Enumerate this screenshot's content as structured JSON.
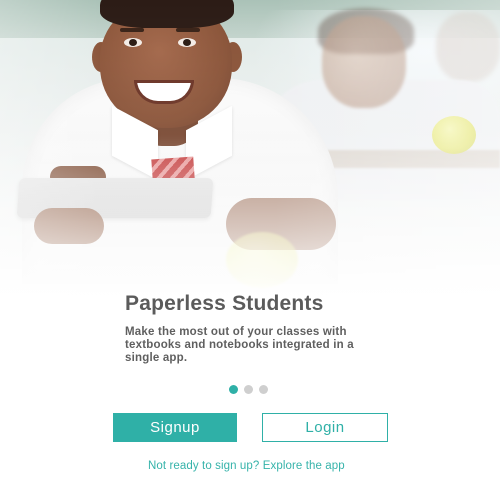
{
  "onboarding": {
    "title": "Paperless Students",
    "description": "Make the most out of your classes with textbooks and notebooks integrated in a single app.",
    "hero_image": "student-with-tablet-illustration",
    "pagination": {
      "current": 1,
      "total": 3
    },
    "signup_label": "Signup",
    "login_label": "Login",
    "explore_link": "Not ready to sign up? Explore the app"
  },
  "colors": {
    "accent": "#2fb0a7",
    "title_text": "#5b5b5b",
    "body_text": "#5f5f5f",
    "dot_inactive": "#cfcfcf",
    "background": "#ffffff"
  }
}
